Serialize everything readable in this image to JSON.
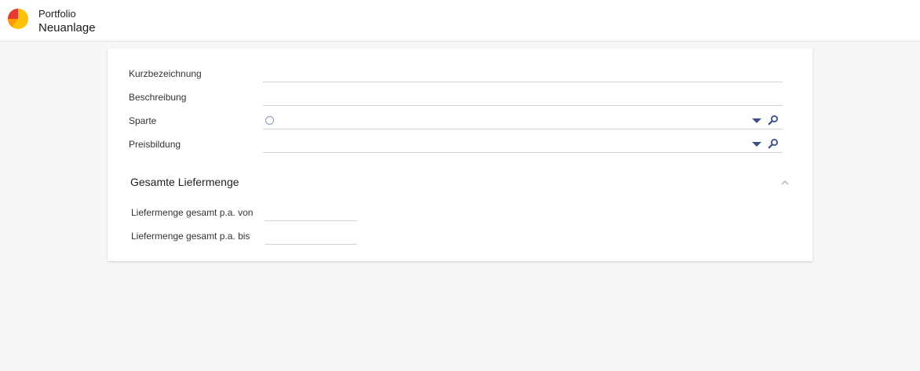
{
  "header": {
    "app_title": "Portfolio",
    "page_title": "Neuanlage",
    "logo_icon": "pie-chart-icon",
    "logo_colors": {
      "primary": "#ffc107",
      "secondary": "#ff9800",
      "accent": "#e53935"
    }
  },
  "form": {
    "fields": [
      {
        "label": "Kurzbezeichnung",
        "value": ""
      },
      {
        "label": "Beschreibung",
        "value": ""
      },
      {
        "label": "Sparte",
        "value": "",
        "has_radio": true,
        "has_dropdown": true,
        "has_search": true
      },
      {
        "label": "Preisbildung",
        "value": "",
        "has_dropdown": true,
        "has_search": true
      }
    ]
  },
  "section": {
    "title": "Gesamte Liefermenge",
    "collapse_icon": "chevron-up-icon",
    "fields": [
      {
        "label": "Liefermenge gesamt p.a. von",
        "value": ""
      },
      {
        "label": "Liefermenge gesamt p.a. bis",
        "value": ""
      }
    ]
  },
  "colors": {
    "icon_blue": "#3b4f8a",
    "line": "#d4d4d4",
    "background": "#f6f6f6"
  }
}
